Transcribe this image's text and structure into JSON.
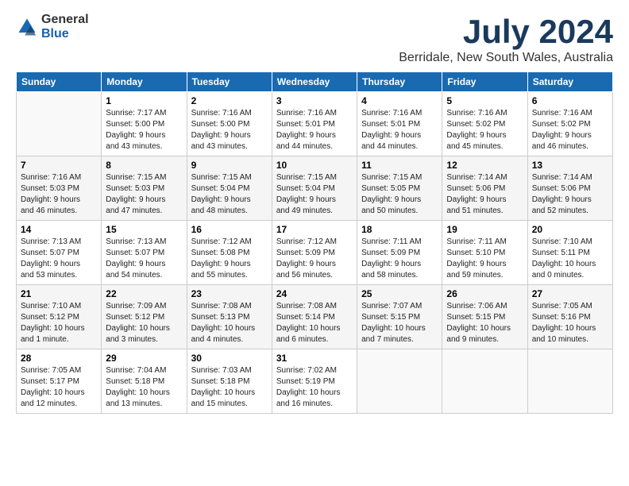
{
  "logo": {
    "general": "General",
    "blue": "Blue"
  },
  "title": "July 2024",
  "subtitle": "Berridale, New South Wales, Australia",
  "days_header": [
    "Sunday",
    "Monday",
    "Tuesday",
    "Wednesday",
    "Thursday",
    "Friday",
    "Saturday"
  ],
  "weeks": [
    [
      {
        "day": "",
        "info": ""
      },
      {
        "day": "1",
        "info": "Sunrise: 7:17 AM\nSunset: 5:00 PM\nDaylight: 9 hours\nand 43 minutes."
      },
      {
        "day": "2",
        "info": "Sunrise: 7:16 AM\nSunset: 5:00 PM\nDaylight: 9 hours\nand 43 minutes."
      },
      {
        "day": "3",
        "info": "Sunrise: 7:16 AM\nSunset: 5:01 PM\nDaylight: 9 hours\nand 44 minutes."
      },
      {
        "day": "4",
        "info": "Sunrise: 7:16 AM\nSunset: 5:01 PM\nDaylight: 9 hours\nand 44 minutes."
      },
      {
        "day": "5",
        "info": "Sunrise: 7:16 AM\nSunset: 5:02 PM\nDaylight: 9 hours\nand 45 minutes."
      },
      {
        "day": "6",
        "info": "Sunrise: 7:16 AM\nSunset: 5:02 PM\nDaylight: 9 hours\nand 46 minutes."
      }
    ],
    [
      {
        "day": "7",
        "info": "Sunrise: 7:16 AM\nSunset: 5:03 PM\nDaylight: 9 hours\nand 46 minutes."
      },
      {
        "day": "8",
        "info": "Sunrise: 7:15 AM\nSunset: 5:03 PM\nDaylight: 9 hours\nand 47 minutes."
      },
      {
        "day": "9",
        "info": "Sunrise: 7:15 AM\nSunset: 5:04 PM\nDaylight: 9 hours\nand 48 minutes."
      },
      {
        "day": "10",
        "info": "Sunrise: 7:15 AM\nSunset: 5:04 PM\nDaylight: 9 hours\nand 49 minutes."
      },
      {
        "day": "11",
        "info": "Sunrise: 7:15 AM\nSunset: 5:05 PM\nDaylight: 9 hours\nand 50 minutes."
      },
      {
        "day": "12",
        "info": "Sunrise: 7:14 AM\nSunset: 5:06 PM\nDaylight: 9 hours\nand 51 minutes."
      },
      {
        "day": "13",
        "info": "Sunrise: 7:14 AM\nSunset: 5:06 PM\nDaylight: 9 hours\nand 52 minutes."
      }
    ],
    [
      {
        "day": "14",
        "info": "Sunrise: 7:13 AM\nSunset: 5:07 PM\nDaylight: 9 hours\nand 53 minutes."
      },
      {
        "day": "15",
        "info": "Sunrise: 7:13 AM\nSunset: 5:07 PM\nDaylight: 9 hours\nand 54 minutes."
      },
      {
        "day": "16",
        "info": "Sunrise: 7:12 AM\nSunset: 5:08 PM\nDaylight: 9 hours\nand 55 minutes."
      },
      {
        "day": "17",
        "info": "Sunrise: 7:12 AM\nSunset: 5:09 PM\nDaylight: 9 hours\nand 56 minutes."
      },
      {
        "day": "18",
        "info": "Sunrise: 7:11 AM\nSunset: 5:09 PM\nDaylight: 9 hours\nand 58 minutes."
      },
      {
        "day": "19",
        "info": "Sunrise: 7:11 AM\nSunset: 5:10 PM\nDaylight: 9 hours\nand 59 minutes."
      },
      {
        "day": "20",
        "info": "Sunrise: 7:10 AM\nSunset: 5:11 PM\nDaylight: 10 hours\nand 0 minutes."
      }
    ],
    [
      {
        "day": "21",
        "info": "Sunrise: 7:10 AM\nSunset: 5:12 PM\nDaylight: 10 hours\nand 1 minute."
      },
      {
        "day": "22",
        "info": "Sunrise: 7:09 AM\nSunset: 5:12 PM\nDaylight: 10 hours\nand 3 minutes."
      },
      {
        "day": "23",
        "info": "Sunrise: 7:08 AM\nSunset: 5:13 PM\nDaylight: 10 hours\nand 4 minutes."
      },
      {
        "day": "24",
        "info": "Sunrise: 7:08 AM\nSunset: 5:14 PM\nDaylight: 10 hours\nand 6 minutes."
      },
      {
        "day": "25",
        "info": "Sunrise: 7:07 AM\nSunset: 5:15 PM\nDaylight: 10 hours\nand 7 minutes."
      },
      {
        "day": "26",
        "info": "Sunrise: 7:06 AM\nSunset: 5:15 PM\nDaylight: 10 hours\nand 9 minutes."
      },
      {
        "day": "27",
        "info": "Sunrise: 7:05 AM\nSunset: 5:16 PM\nDaylight: 10 hours\nand 10 minutes."
      }
    ],
    [
      {
        "day": "28",
        "info": "Sunrise: 7:05 AM\nSunset: 5:17 PM\nDaylight: 10 hours\nand 12 minutes."
      },
      {
        "day": "29",
        "info": "Sunrise: 7:04 AM\nSunset: 5:18 PM\nDaylight: 10 hours\nand 13 minutes."
      },
      {
        "day": "30",
        "info": "Sunrise: 7:03 AM\nSunset: 5:18 PM\nDaylight: 10 hours\nand 15 minutes."
      },
      {
        "day": "31",
        "info": "Sunrise: 7:02 AM\nSunset: 5:19 PM\nDaylight: 10 hours\nand 16 minutes."
      },
      {
        "day": "",
        "info": ""
      },
      {
        "day": "",
        "info": ""
      },
      {
        "day": "",
        "info": ""
      }
    ]
  ]
}
